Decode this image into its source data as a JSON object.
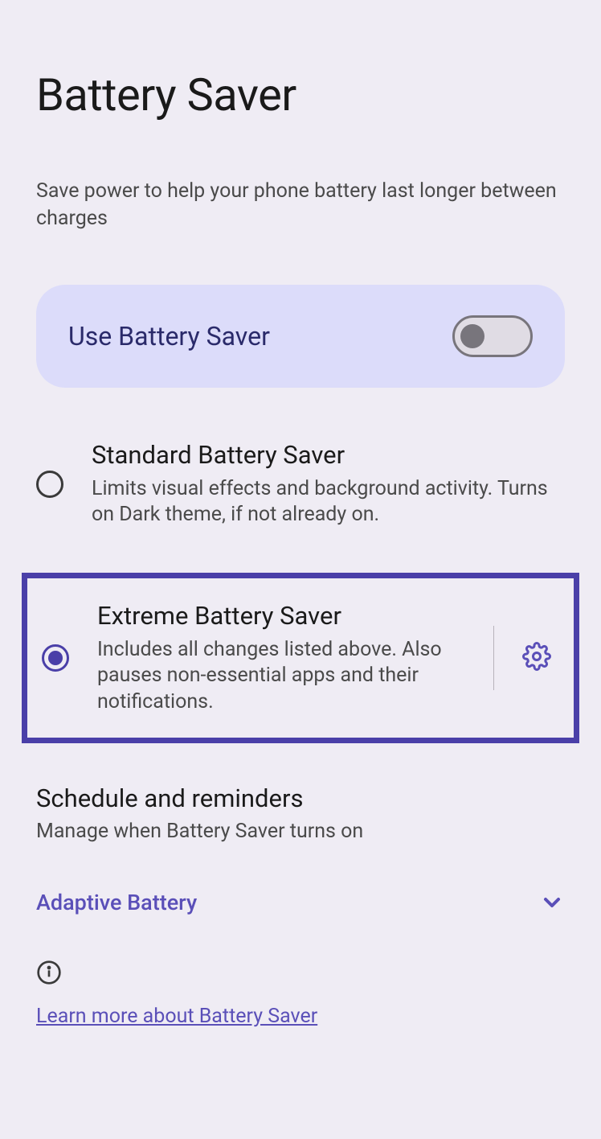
{
  "page": {
    "title": "Battery Saver",
    "subtitle": "Save power to help your phone battery last longer between charges"
  },
  "toggle": {
    "label": "Use Battery Saver",
    "state": "off"
  },
  "options": [
    {
      "title": "Standard Battery Saver",
      "description": "Limits visual effects and background activity. Turns on Dark theme, if not already on.",
      "selected": false
    },
    {
      "title": "Extreme Battery Saver",
      "description": "Includes all changes listed above. Also pauses non-essential apps and their notifications.",
      "selected": true
    }
  ],
  "schedule": {
    "title": "Schedule and reminders",
    "description": "Manage when Battery Saver turns on"
  },
  "adaptive": {
    "label": "Adaptive Battery"
  },
  "learn": {
    "label": "Learn more about Battery Saver"
  }
}
